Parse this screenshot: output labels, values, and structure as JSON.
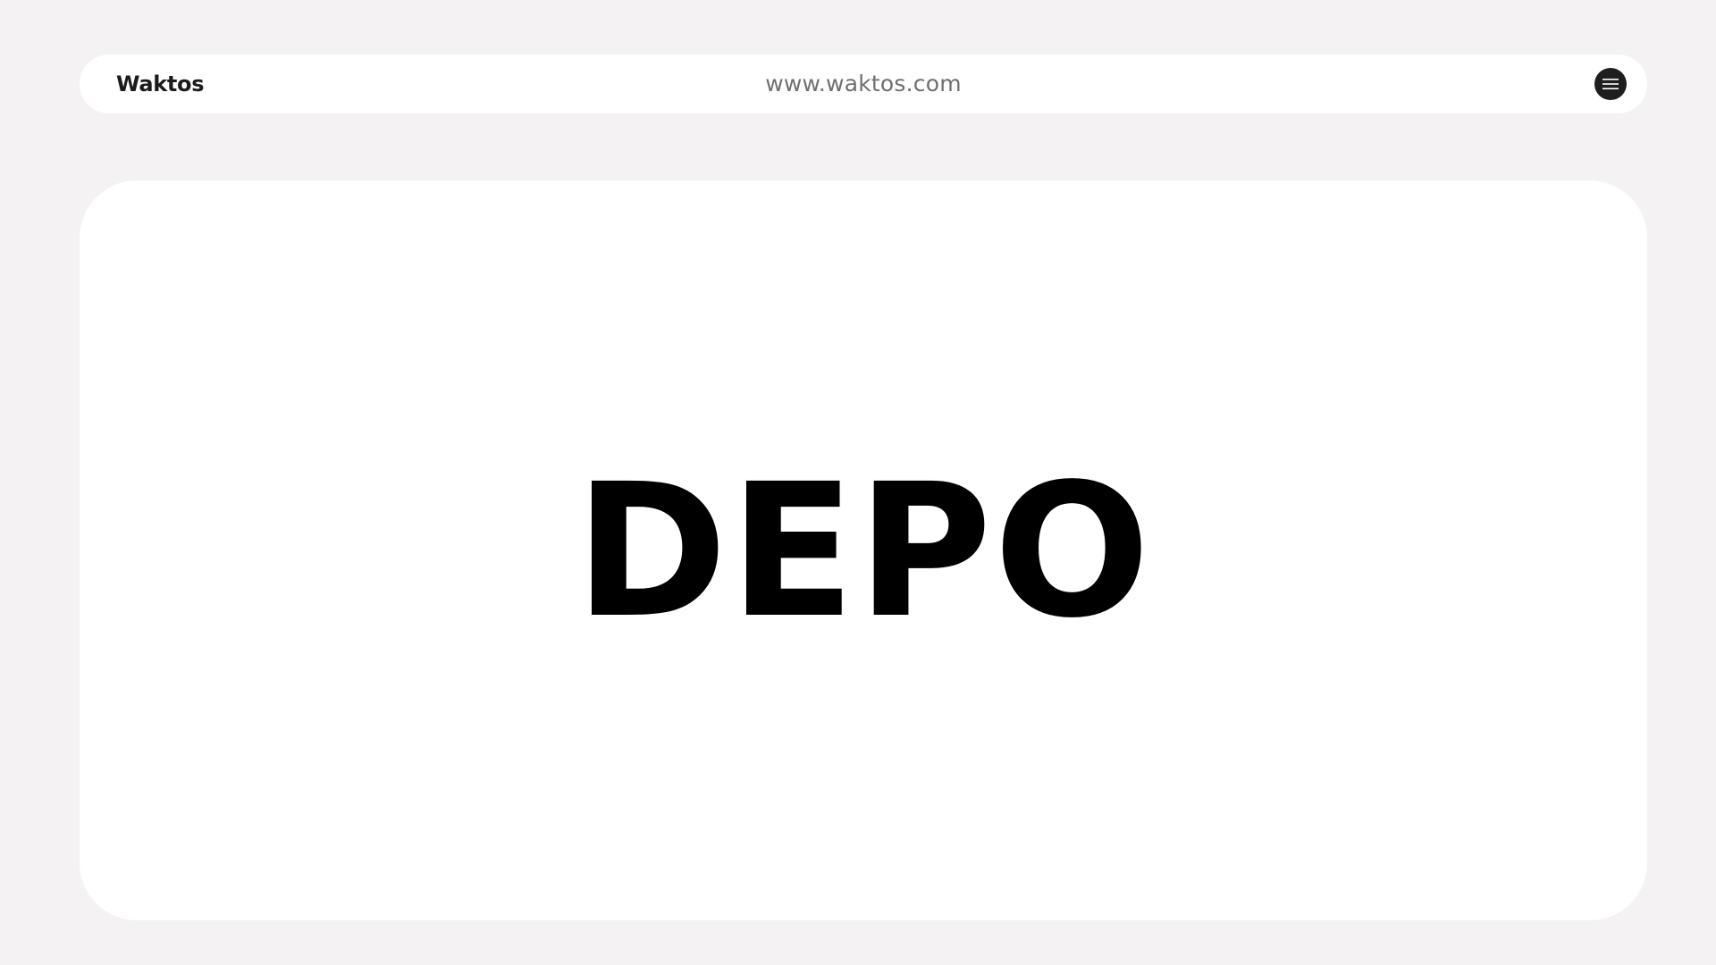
{
  "header": {
    "brand": "Waktos",
    "url": "www.waktos.com",
    "menu_icon": "hamburger-menu-icon"
  },
  "main": {
    "title": "DEPO"
  },
  "colors": {
    "background": "#f4f2f2",
    "surface": "#ffffff",
    "menu_button": "#1e1e1e",
    "url_text": "#6f6f6f",
    "title_text": "#000000"
  }
}
